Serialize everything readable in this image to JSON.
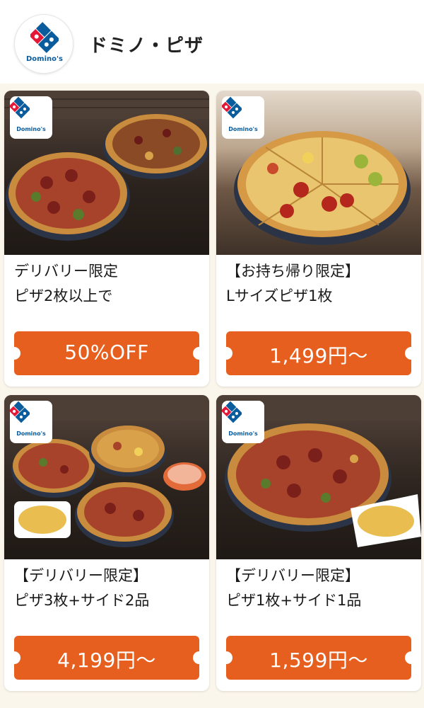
{
  "header": {
    "brand_name": "ドミノ・ピザ",
    "logo_icon": "dominos-logo-icon",
    "logo_wordmark": "Domino's"
  },
  "colors": {
    "accent": "#e65f1e",
    "background": "#fbf6ec",
    "logo_blue": "#0b5c9c",
    "logo_red": "#e31837"
  },
  "cards": [
    {
      "title_line1": "デリバリー限定",
      "title_line2": "ピザ2枚以上で",
      "price": "50%OFF",
      "badge": "Domino's"
    },
    {
      "title_line1": "【お持ち帰り限定】",
      "title_line2": "Lサイズピザ1枚",
      "price": "1,499円〜",
      "badge": "Domino's"
    },
    {
      "title_line1": "【デリバリー限定】",
      "title_line2": "ピザ3枚+サイド2品",
      "price": "4,199円〜",
      "badge": "Domino's"
    },
    {
      "title_line1": "【デリバリー限定】",
      "title_line2": "ピザ1枚+サイド1品",
      "price": "1,599円〜",
      "badge": "Domino's"
    }
  ]
}
